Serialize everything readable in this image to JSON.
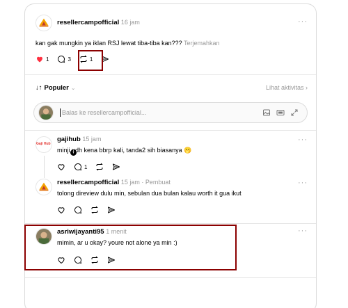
{
  "post": {
    "author": "resellercampofficial",
    "time": "16 jam",
    "text": "kan gak mungkin ya iklan RSJ lewat tiba-tiba kan???",
    "translate": "Terjemahkan",
    "likes": "1",
    "comments": "3",
    "reposts": "1",
    "more": "···"
  },
  "sort": {
    "label": "Populer",
    "activity": "Lihat aktivitas ›"
  },
  "reply": {
    "placeholder": "Balas ke resellercampofficial..."
  },
  "replies": [
    {
      "author": "gajihub",
      "meta": "15 jam",
      "text": "minji udh kena bbrp kali, tanda2 sih biasanya 🫢",
      "comments": "1",
      "more": "···",
      "avatar_label": "Gaji Hub"
    },
    {
      "author": "resellercampofficial",
      "meta": "15 jam · Pembuat",
      "text": "tolong direview dulu min, sebulan dua bulan kalau worth it gua ikut",
      "more": "···"
    },
    {
      "author": "asriwijayanti95",
      "meta": "1 menit",
      "text": "mimin, ar u okay? youre not alone ya min :)",
      "more": "···"
    }
  ],
  "colors": {
    "heart": "#ff3040",
    "highlight": "#8b0000"
  },
  "icons": [
    "heart-icon",
    "comment-icon",
    "repost-icon",
    "share-icon",
    "sort-icon",
    "image-icon",
    "gif-icon",
    "expand-icon",
    "more-icon"
  ]
}
